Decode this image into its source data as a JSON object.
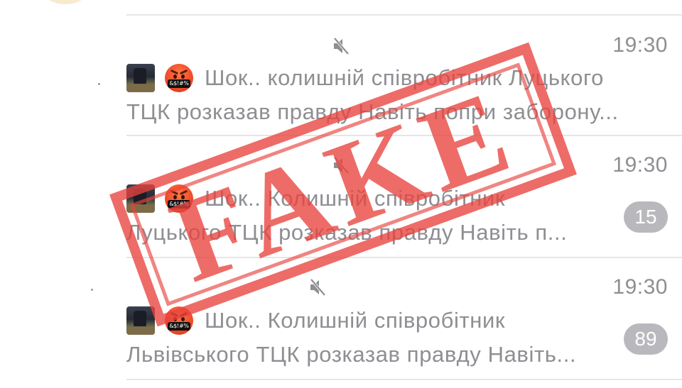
{
  "chats": [
    {
      "time": "19:30",
      "muted": true,
      "line1": "Шок.. колишній співробітник Луцького",
      "line2": "ТЦК розказав правду Навіть попри заборону...",
      "badge": ""
    },
    {
      "time": "19:30",
      "muted": true,
      "line1": "Шок.. Колишній співробітник",
      "line2": "Луцького ТЦК розказав правду Навіть п...",
      "badge": "15"
    },
    {
      "time": "19:30",
      "muted": true,
      "line1": "Шок.. Колишній співробітник",
      "line2": "Львівського ТЦК розказав правду Навіть...",
      "badge": "89"
    }
  ],
  "emoji_symbol": "&$!#%",
  "stamp": {
    "text": "FAKE",
    "color": "#e8433d"
  },
  "colors": {
    "secondary_text": "#8e8e93",
    "badge_bg": "#b9b9bd",
    "divider": "#e6e6e6"
  },
  "icons": {
    "mute": "speaker-muted-icon",
    "emoji": "angry-face-symbols-emoji"
  }
}
